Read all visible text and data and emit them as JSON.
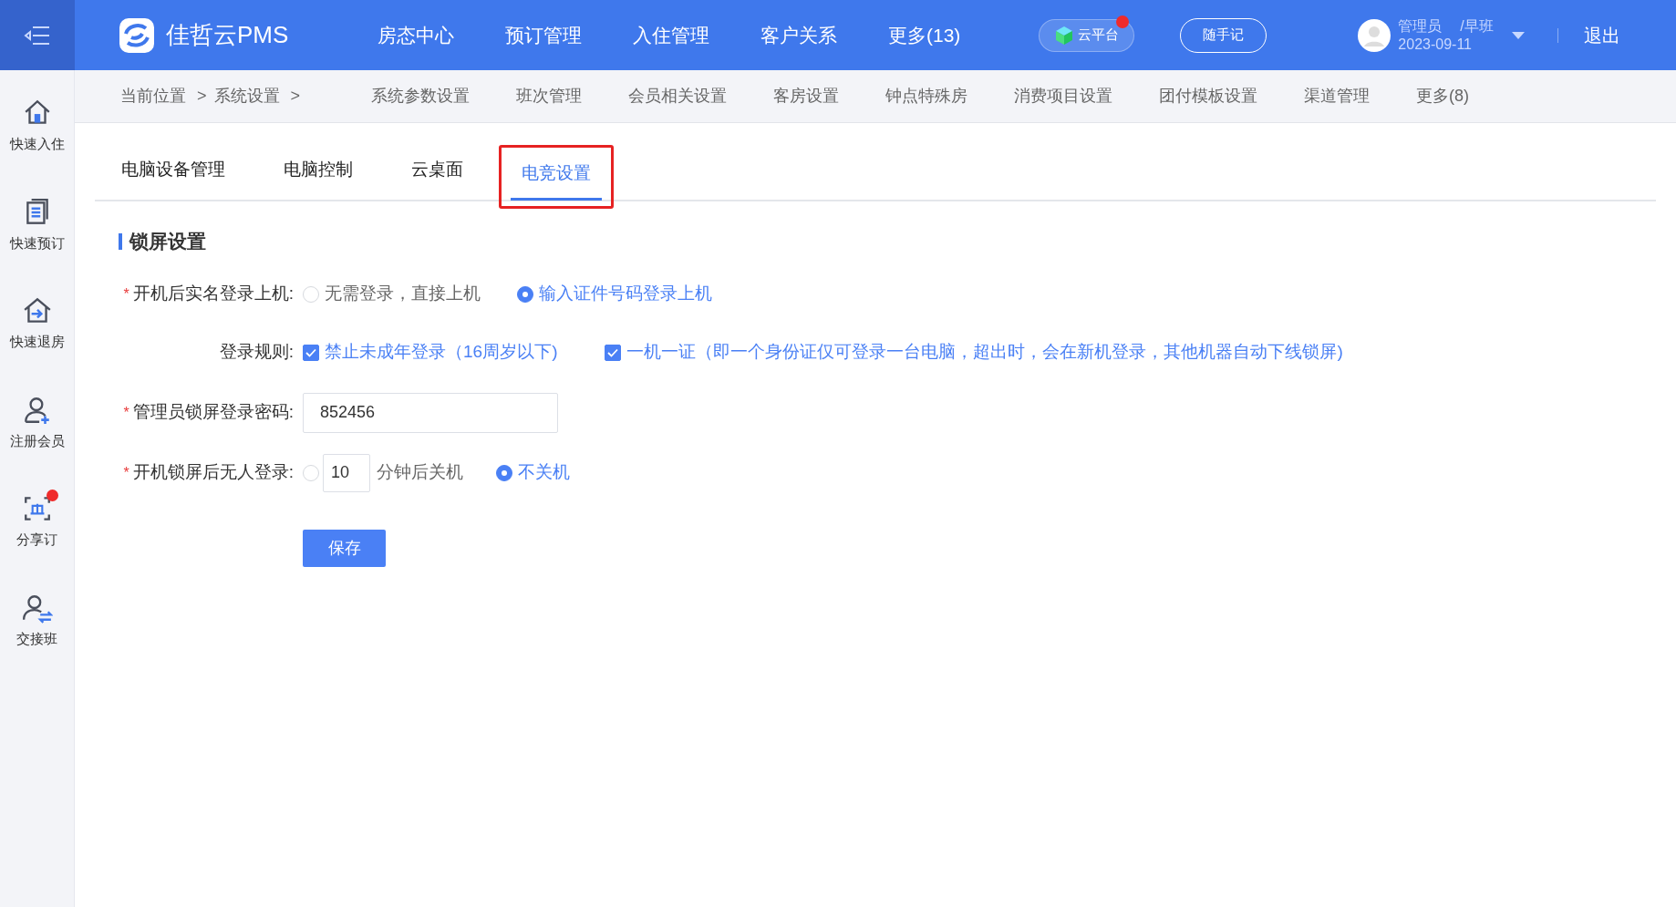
{
  "header": {
    "brand": "佳哲云PMS",
    "nav": [
      "房态中心",
      "预订管理",
      "入住管理",
      "客户关系",
      "更多(13)"
    ],
    "cloud_button": {
      "label": "云平台",
      "notification": true
    },
    "note_button": "随手记",
    "user": {
      "name": "管理员",
      "shift": "/早班",
      "date": "2023-09-11"
    },
    "logout": "退出"
  },
  "sidebar": [
    {
      "label": "快速入住",
      "kind": "home",
      "notification": false
    },
    {
      "label": "快速预订",
      "kind": "list",
      "notification": false
    },
    {
      "label": "快速退房",
      "kind": "checkout",
      "notification": false
    },
    {
      "label": "注册会员",
      "kind": "adduser",
      "notification": false
    },
    {
      "label": "分享订",
      "kind": "share",
      "notification": true
    },
    {
      "label": "交接班",
      "kind": "swap",
      "notification": false
    }
  ],
  "breadcrumb": [
    {
      "label": "当前位置",
      "separator": ">"
    },
    {
      "label": "系统设置",
      "separator": ">"
    }
  ],
  "subnav": [
    "系统参数设置",
    "班次管理",
    "会员相关设置",
    "客房设置",
    "钟点特殊房",
    "消费项目设置",
    "团付模板设置",
    "渠道管理",
    "更多(8)"
  ],
  "tabs": [
    {
      "label": "电脑设备管理",
      "selected": false
    },
    {
      "label": "电脑控制",
      "selected": false
    },
    {
      "label": "云桌面",
      "selected": false
    },
    {
      "label": "电竞设置",
      "selected": true
    }
  ],
  "section_title": "锁屏设置",
  "form": [
    {
      "kind": "radio",
      "label": "开机后实名登录上机:",
      "required_mark": "*",
      "options": [
        {
          "label": "无需登录，直接上机",
          "selected": false
        },
        {
          "label": "输入证件号码登录上机",
          "selected": true
        }
      ]
    },
    {
      "kind": "checkbox",
      "label": "登录规则:",
      "options": [
        {
          "label": "禁止未成年登录（16周岁以下)",
          "checked": true
        },
        {
          "label": "一机一证（即一个身份证仅可登录一台电脑，超出时，会在新机登录，其他机器自动下线锁屏)",
          "checked": true
        }
      ]
    },
    {
      "kind": "input",
      "label": "管理员锁屏登录密码:",
      "required_mark": "*",
      "value": "852456"
    },
    {
      "kind": "shutdown",
      "label": "开机锁屏后无人登录:",
      "required_mark": "*",
      "shutdown_selected": false,
      "minutes": "10",
      "minutes_suffix": "分钟后关机",
      "never_label": "不关机",
      "never_selected": true
    }
  ],
  "save_button": "保存"
}
